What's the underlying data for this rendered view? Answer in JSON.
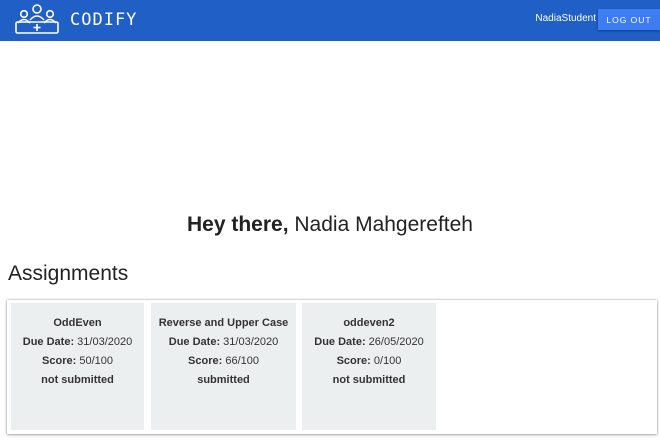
{
  "header": {
    "brand": "CODIFY",
    "logo_icon": "people-group-logo-icon",
    "username": "NadiaStudent",
    "logout_label": "LOG OUT",
    "bar_color": "#1f5fc6",
    "button_color": "#3d7cf1"
  },
  "greeting": {
    "prefix": "Hey there,",
    "name": "Nadia Mahgerefteh"
  },
  "assignments": {
    "heading": "Assignments",
    "due_label": "Due Date:",
    "score_label": "Score:",
    "items": [
      {
        "title": "OddEven",
        "due": "31/03/2020",
        "score": "50/100",
        "status": "not submitted"
      },
      {
        "title": "Reverse and Upper Case",
        "due": "31/03/2020",
        "score": "66/100",
        "status": "submitted"
      },
      {
        "title": "oddeven2",
        "due": "26/05/2020",
        "score": "0/100",
        "status": "not submitted"
      }
    ]
  }
}
